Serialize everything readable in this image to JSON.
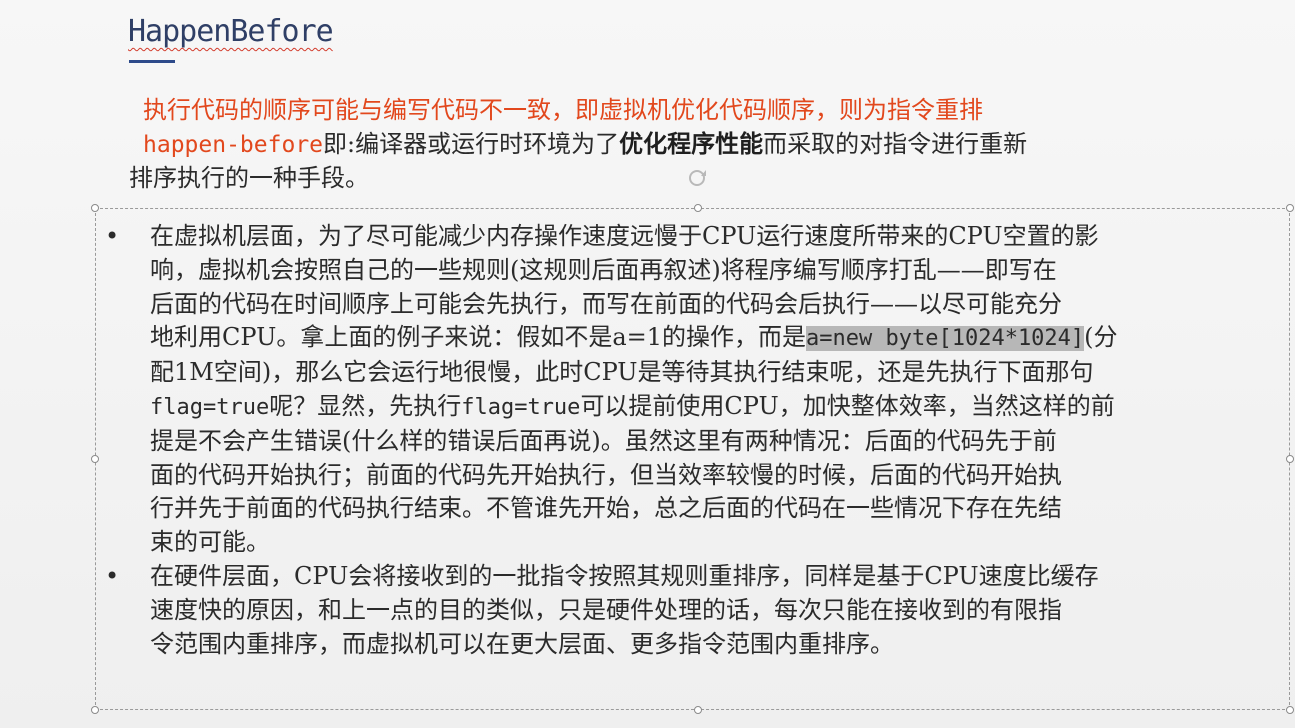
{
  "slide": {
    "title": "HappenBefore",
    "intro": {
      "line1": "执行代码的顺序可能与编写代码不一致，即虚拟机优化代码顺序，则为指令重排",
      "line2_code": "happen-before",
      "line2_a": "即:编译器或运行时环境为了",
      "line2_bold": "优化程序性能",
      "line2_b": "而采取的对指令进行重新",
      "line3": "排序执行的一种手段。"
    },
    "bullet_symbol": "•",
    "bullet1": {
      "l1": "在虚拟机层面，为了尽可能减少内存操作速度远慢于CPU运行速度所带来的CPU空置的影",
      "l2": "响，虚拟机会按照自己的一些规则(这规则后面再叙述)将程序编写顺序打乱——即写在",
      "l3": "后面的代码在时间顺序上可能会先执行，而写在前面的代码会后执行——以尽可能充分",
      "l4a": "地利用CPU。拿上面的例子来说：假如不是a=1的操作，而是",
      "l4_code": "a=new byte[1024*1024]",
      "l4b": "(分",
      "l5": "配1M空间)，那么它会运行地很慢，此时CPU是等待其执行结束呢，还是先执行下面那句",
      "l6_code1": "flag=true",
      "l6a": "呢？显然，先执行",
      "l6_code2": "flag=true",
      "l6b": "可以提前使用CPU，加快整体效率，当然这样的前",
      "l7": "提是不会产生错误(什么样的错误后面再说)。虽然这里有两种情况：后面的代码先于前",
      "l8": "面的代码开始执行；前面的代码先开始执行，但当效率较慢的时候，后面的代码开始执",
      "l9": "行并先于前面的代码执行结束。不管谁先开始，总之后面的代码在一些情况下存在先结",
      "l10": "束的可能。"
    },
    "bullet2": {
      "l1": "在硬件层面，CPU会将接收到的一批指令按照其规则重排序，同样是基于CPU速度比缓存",
      "l2": "速度快的原因，和上一点的目的类似，只是硬件处理的话，每次只能在接收到的有限指",
      "l3": "令范围内重排序，而虚拟机可以在更大层面、更多指令范围内重排序。"
    }
  },
  "colors": {
    "accent_red": "#e2481d",
    "title_blue": "#2f3f66"
  }
}
